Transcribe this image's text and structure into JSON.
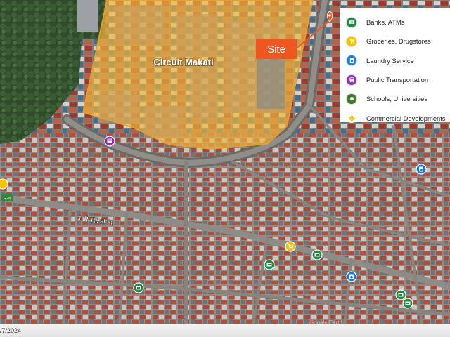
{
  "map": {
    "landmark_label": "Circuit Makati",
    "street_label": "J. P. Rizal St",
    "road_shield": "R-4",
    "site_label": "Site",
    "date_text": "/7/2024",
    "attribution": "Google Earth"
  },
  "legend": {
    "items": [
      {
        "label": "Banks, ATMs",
        "icon": "bank-icon",
        "color": "#1e8a44"
      },
      {
        "label": "Groceries, Drugstores",
        "icon": "cart-icon",
        "color": "#f5c400"
      },
      {
        "label": "Laundry Service",
        "icon": "laundry-icon",
        "color": "#1c7bd6"
      },
      {
        "label": "Public Transportation",
        "icon": "bus-icon",
        "color": "#8a2fb8"
      },
      {
        "label": "Schools, Universities",
        "icon": "graduation-cap-icon",
        "color": "#3f7d2c"
      },
      {
        "label": "Commercial Developments",
        "icon": "diamond-icon",
        "color": "#f2d000"
      }
    ]
  },
  "colors": {
    "site_accent": "#f0561f",
    "highlight_fill": "#f1b63c",
    "highlight_stroke": "#f0a020"
  }
}
